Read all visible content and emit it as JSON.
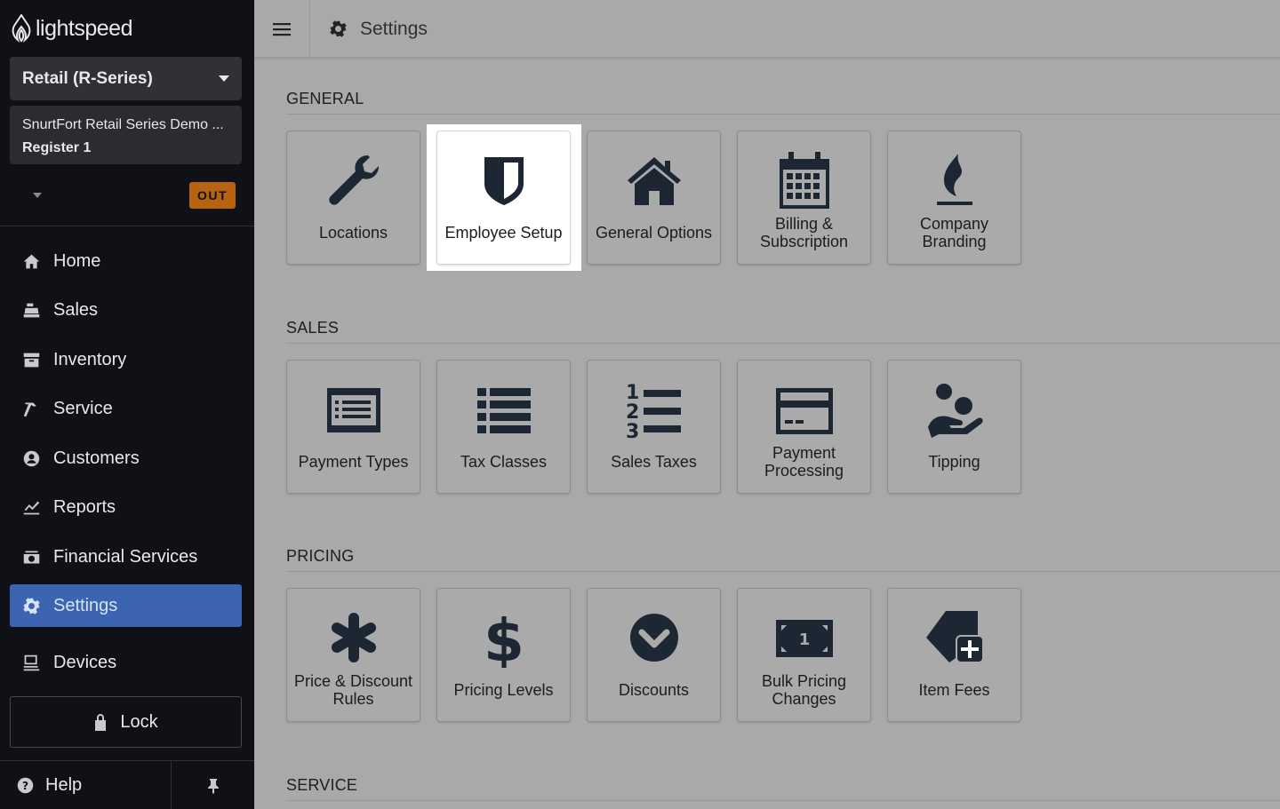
{
  "brand": {
    "name": "lightspeed"
  },
  "sidebar": {
    "product_select": "Retail (R-Series)",
    "store_name": "SnurtFort Retail Series Demo ...",
    "register": "Register 1",
    "status_badge": "OUT",
    "items": [
      {
        "label": "Home",
        "icon": "home-icon"
      },
      {
        "label": "Sales",
        "icon": "register-icon"
      },
      {
        "label": "Inventory",
        "icon": "inventory-icon"
      },
      {
        "label": "Service",
        "icon": "hammer-icon"
      },
      {
        "label": "Customers",
        "icon": "user-circle-icon"
      },
      {
        "label": "Reports",
        "icon": "chart-icon"
      },
      {
        "label": "Financial Services",
        "icon": "money-icon"
      },
      {
        "label": "Settings",
        "icon": "gear-icon",
        "active": true
      },
      {
        "label": "Devices",
        "icon": "devices-icon"
      }
    ],
    "lock_label": "Lock",
    "help_label": "Help"
  },
  "header": {
    "title": "Settings"
  },
  "sections": {
    "general": {
      "title": "GENERAL",
      "tiles": [
        "Locations",
        "Employee Setup",
        "General Options",
        "Billing & Subscription",
        "Company Branding"
      ]
    },
    "sales": {
      "title": "SALES",
      "tiles": [
        "Payment Types",
        "Tax Classes",
        "Sales Taxes",
        "Payment Processing",
        "Tipping"
      ]
    },
    "pricing": {
      "title": "PRICING",
      "tiles": [
        "Price & Discount Rules",
        "Pricing Levels",
        "Discounts",
        "Bulk Pricing Changes",
        "Item Fees"
      ]
    },
    "service": {
      "title": "SERVICE"
    }
  },
  "colors": {
    "sidebar_bg": "#101116",
    "active_nav": "#3c64b1",
    "badge": "#b86311",
    "overlay": "#a9a9a9",
    "icon": "#1c2733"
  }
}
